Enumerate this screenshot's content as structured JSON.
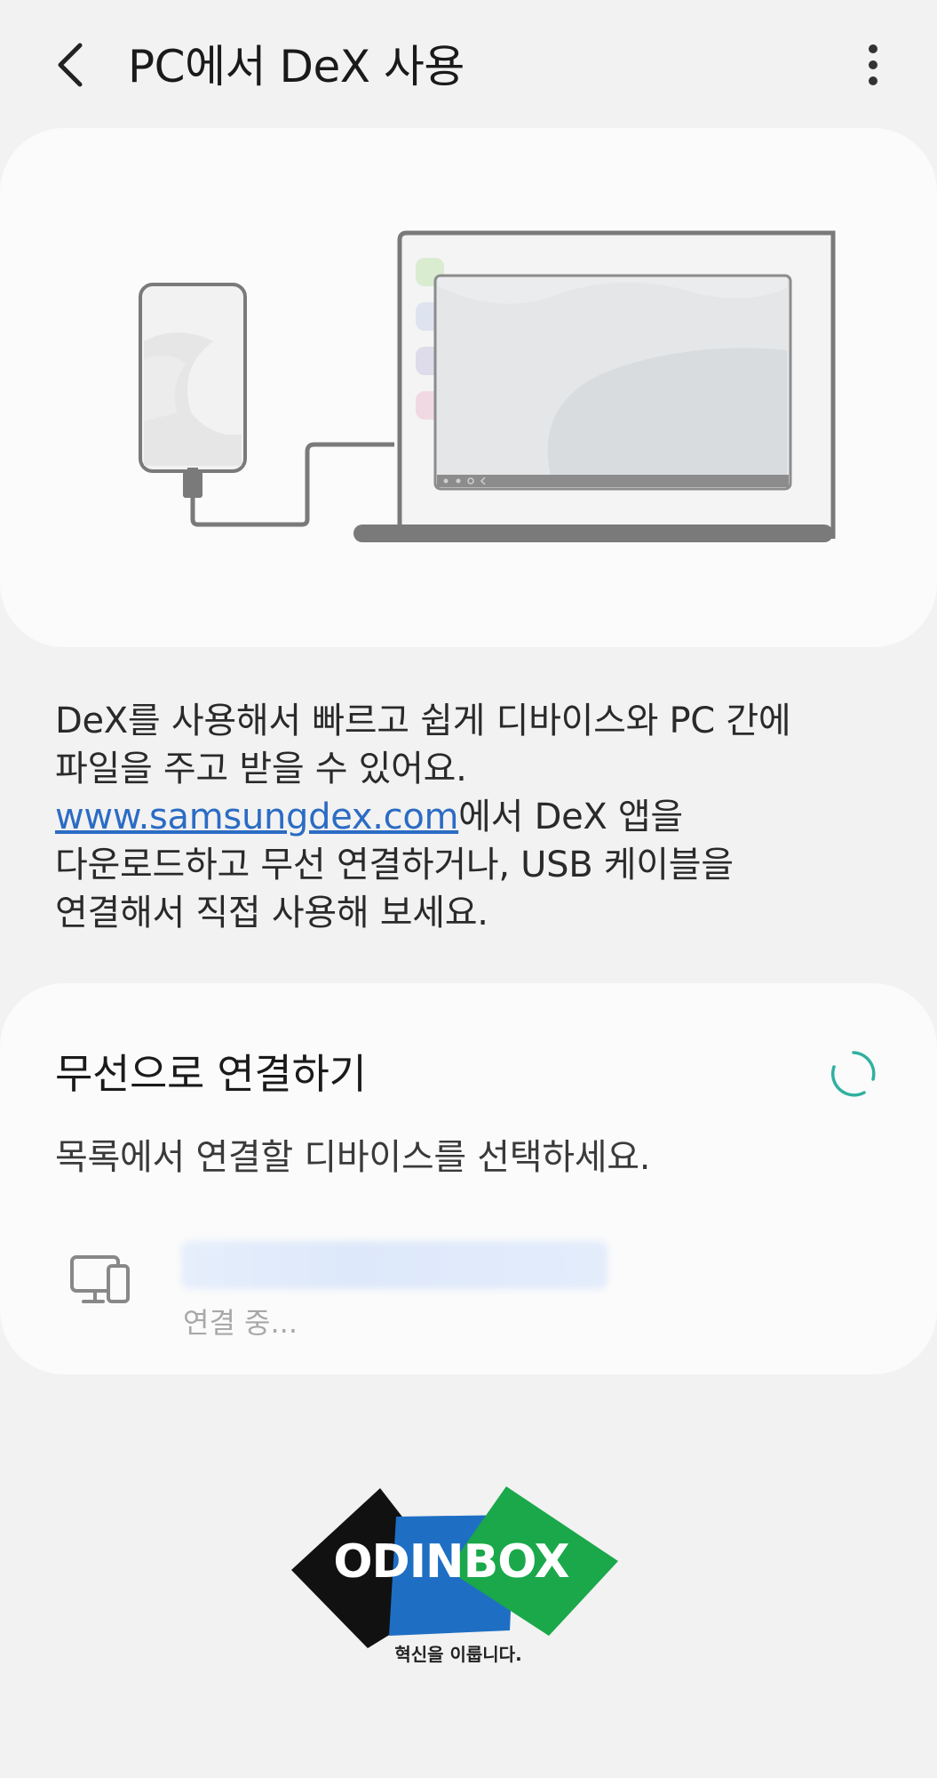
{
  "header": {
    "title": "PC에서 DeX 사용",
    "back_icon": "chevron-left-icon",
    "more_icon": "more-vertical-icon"
  },
  "illustration": {
    "icon": "phone-to-laptop-dex-illustration"
  },
  "description": {
    "line1": "DeX를 사용해서 빠르고 쉽게 디바이스와 PC 간에",
    "line2": "파일을 주고 받을 수 있어요.",
    "link": "www.samsungdex.com",
    "line3_suffix": "에서 DeX 앱을",
    "line4": "다운로드하고 무선 연결하거나, USB 케이블을",
    "line5": "연결해서 직접 사용해 보세요."
  },
  "wireless": {
    "title": "무선으로 연결하기",
    "subtitle": "목록에서 연결할 디바이스를 선택하세요.",
    "spinner_icon": "loading-spinner-icon",
    "device": {
      "icon": "monitor-phone-icon",
      "status": "연결 중..."
    }
  },
  "watermark": {
    "brand": "ODINBOX",
    "tagline": "혁신을 이룹니다."
  },
  "colors": {
    "background": "#f2f2f2",
    "card": "#fbfbfb",
    "link": "#2b6cc4",
    "spinner": "#2fb0a0",
    "logo_black": "#111111",
    "logo_blue": "#1e6fc4",
    "logo_green": "#1aa84a"
  }
}
